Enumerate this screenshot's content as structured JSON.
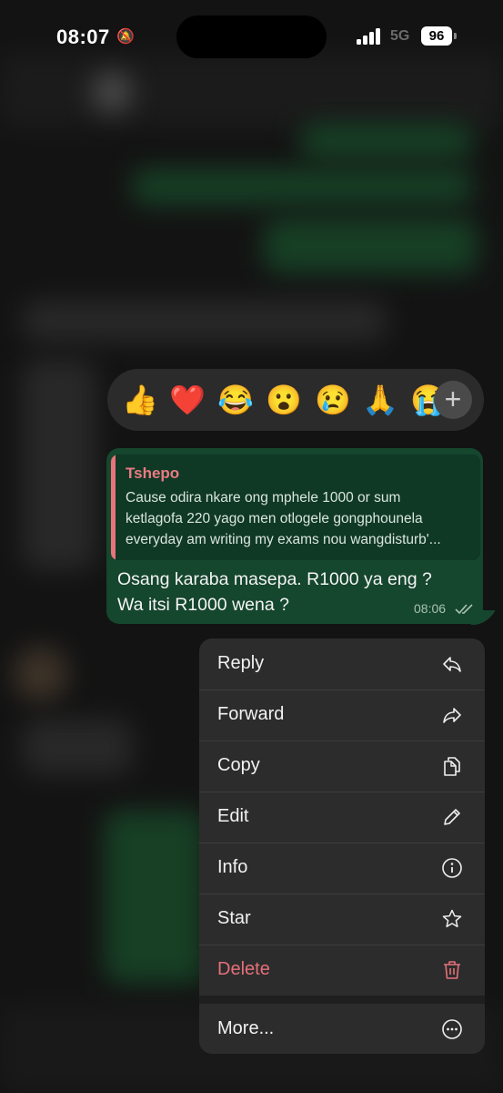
{
  "status_bar": {
    "time": "08:07",
    "network": "5G",
    "battery": "96"
  },
  "reactions": {
    "emojis": [
      "👍",
      "❤️",
      "😂",
      "😮",
      "😢",
      "🙏",
      "😭"
    ],
    "more_label": "+"
  },
  "message": {
    "quote": {
      "author": "Tshepo",
      "lines": [
        "Cause odira nkare ong mphele 1000 or sum",
        "ketlagofa 220 yago men otlogele gongphounela",
        "everyday am writing my exams nou wangdisturb'..."
      ]
    },
    "text_line1": "Osang karaba masepa. R1000 ya eng ?",
    "text_line2": "Wa itsi R1000 wena ?",
    "time": "08:06",
    "status": "read"
  },
  "menu": {
    "items": [
      {
        "label": "Reply",
        "icon": "reply-icon"
      },
      {
        "label": "Forward",
        "icon": "forward-icon"
      },
      {
        "label": "Copy",
        "icon": "copy-icon"
      },
      {
        "label": "Edit",
        "icon": "pencil-icon"
      },
      {
        "label": "Info",
        "icon": "info-icon"
      },
      {
        "label": "Star",
        "icon": "star-icon"
      },
      {
        "label": "Delete",
        "icon": "trash-icon"
      },
      {
        "label": "More...",
        "icon": "more-icon"
      }
    ]
  },
  "colors": {
    "bubble": "#15462e",
    "quote_author": "#ea7b82",
    "delete": "#e5707a",
    "menu_bg": "#2c2c2c"
  }
}
